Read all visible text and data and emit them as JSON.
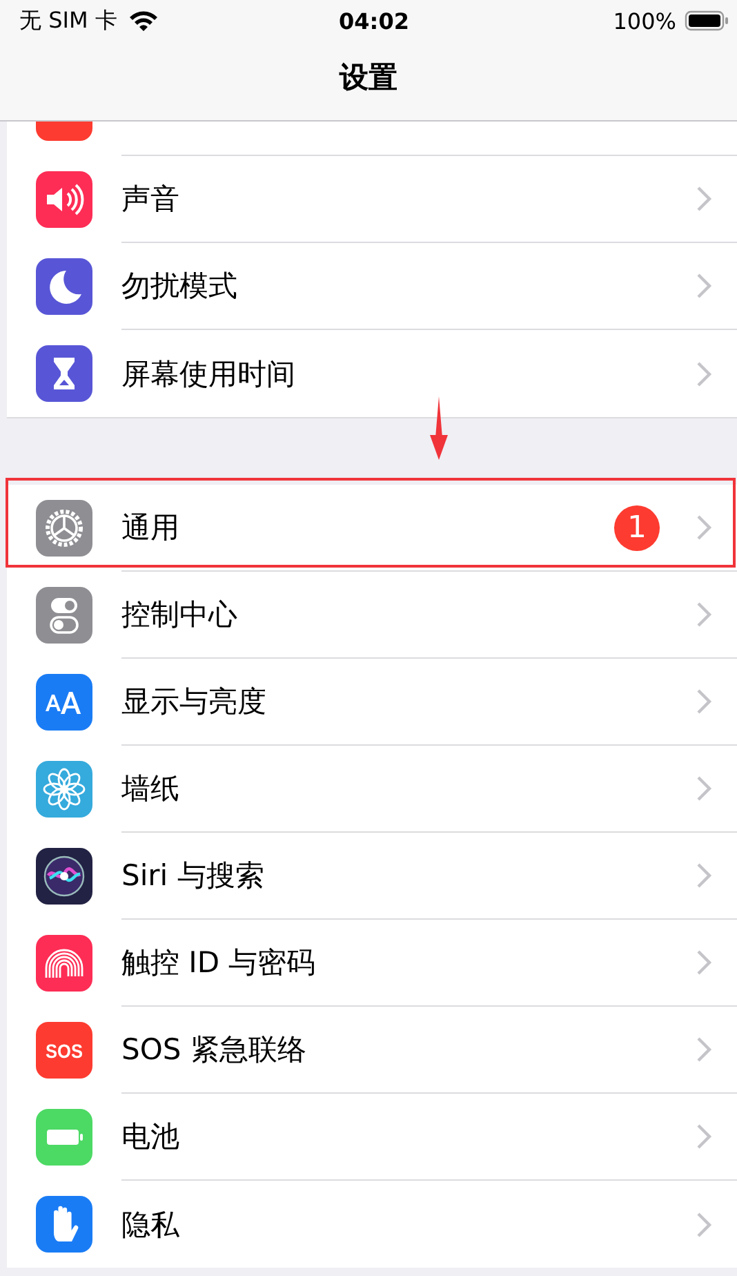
{
  "status_bar": {
    "carrier": "无 SIM 卡",
    "time": "04:02",
    "battery": "100%"
  },
  "nav_bar": {
    "title": "设置"
  },
  "groups": [
    {
      "items": [
        {
          "kind": "notifications",
          "color": "#fd3b30"
        },
        {
          "kind": "sounds",
          "label": "声音",
          "color": "#fd2d55"
        },
        {
          "kind": "dnd",
          "label": "勿扰模式",
          "color": "#5856d6"
        },
        {
          "kind": "screentime",
          "label": "屏幕使用时间",
          "color": "#5856d6"
        }
      ]
    },
    {
      "items": [
        {
          "kind": "general",
          "label": "通用",
          "color": "#8e8e93",
          "badge": "1",
          "highlighted": true
        },
        {
          "kind": "control",
          "label": "控制中心",
          "color": "#8e8e93"
        },
        {
          "kind": "display",
          "label": "显示与亮度",
          "color": "#1a7cf5"
        },
        {
          "kind": "wallpaper",
          "label": "墙纸",
          "color": "#35aadc"
        },
        {
          "kind": "siri",
          "label": "Siri 与搜索",
          "color": "#222244"
        },
        {
          "kind": "touchid",
          "label": "触控 ID 与密码",
          "color": "#fd2d55"
        },
        {
          "kind": "sos",
          "label": "SOS 紧急联络",
          "color": "#fd3b30",
          "icon_text": "SOS"
        },
        {
          "kind": "battery",
          "label": "电池",
          "color": "#4cd964"
        },
        {
          "kind": "privacy",
          "label": "隐私",
          "color": "#1a7cf5"
        }
      ]
    }
  ]
}
